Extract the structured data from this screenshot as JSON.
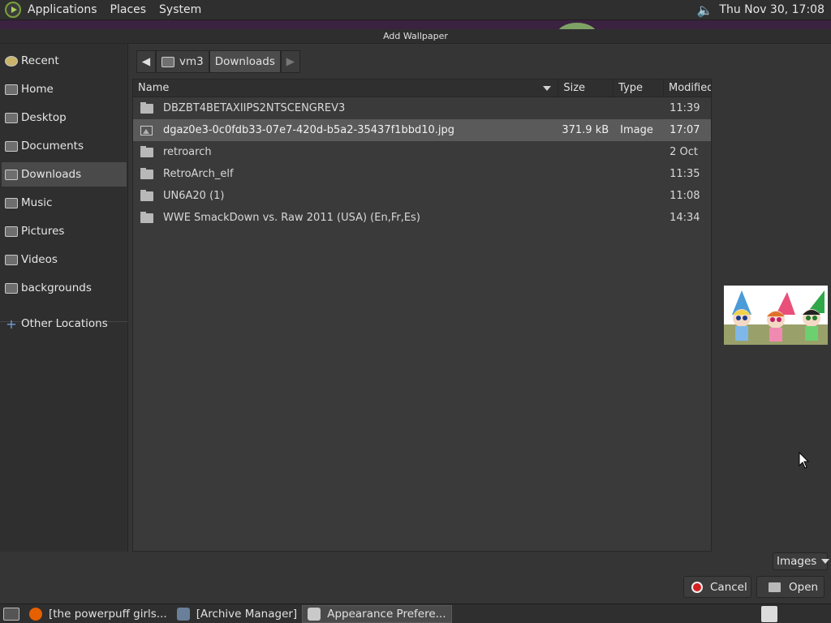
{
  "top_panel": {
    "menus": [
      "Applications",
      "Places",
      "System"
    ],
    "clock": "Thu Nov 30, 17:08",
    "icons": {
      "logo": "distro-logo-icon",
      "volume": "volume-icon"
    }
  },
  "dialog": {
    "title": "Add Wallpaper",
    "sidebar": [
      {
        "label": "Recent",
        "icon": "clock-icon"
      },
      {
        "label": "Home",
        "icon": "home-folder-icon"
      },
      {
        "label": "Desktop",
        "icon": "desktop-folder-icon"
      },
      {
        "label": "Documents",
        "icon": "documents-folder-icon"
      },
      {
        "label": "Downloads",
        "icon": "downloads-folder-icon",
        "active": true
      },
      {
        "label": "Music",
        "icon": "music-folder-icon"
      },
      {
        "label": "Pictures",
        "icon": "pictures-folder-icon"
      },
      {
        "label": "Videos",
        "icon": "videos-folder-icon"
      },
      {
        "label": "backgrounds",
        "icon": "folder-icon"
      },
      {
        "label": "Other Locations",
        "icon": "plus-icon"
      }
    ],
    "pathbar": {
      "home": "vm3",
      "current": "Downloads"
    },
    "columns": {
      "name": "Name",
      "size": "Size",
      "type": "Type",
      "modified": "Modified"
    },
    "files": [
      {
        "name": "DBZBT4BETAXIIPS2NTSCENGREV3",
        "size": "",
        "type": "",
        "modified": "11:39",
        "kind": "folder"
      },
      {
        "name": "dgaz0e3-0c0fdb33-07e7-420d-b5a2-35437f1bbd10.jpg",
        "size": "371.9 kB",
        "type": "Image",
        "modified": "17:07",
        "kind": "image",
        "selected": true
      },
      {
        "name": "retroarch",
        "size": "",
        "type": "",
        "modified": "2 Oct",
        "kind": "folder"
      },
      {
        "name": "RetroArch_elf",
        "size": "",
        "type": "",
        "modified": "11:35",
        "kind": "folder"
      },
      {
        "name": "UN6A20 (1)",
        "size": "",
        "type": "",
        "modified": "11:08",
        "kind": "folder"
      },
      {
        "name": "WWE SmackDown vs. Raw 2011 (USA) (En,Fr,Es)",
        "size": "",
        "type": "",
        "modified": "14:34",
        "kind": "folder"
      }
    ],
    "filter": "Images",
    "buttons": {
      "cancel": "Cancel",
      "open": "Open"
    }
  },
  "taskbar": {
    "tasks": [
      {
        "label": "[the powerpuff girls...",
        "icon": "firefox-icon",
        "color": "#e66000"
      },
      {
        "label": "[Archive Manager]",
        "icon": "archive-manager-icon",
        "color": "#6a7f9a"
      },
      {
        "label": "Appearance Prefere...",
        "icon": "appearance-preferences-icon",
        "color": "#c9c9c9",
        "active": true
      }
    ]
  }
}
